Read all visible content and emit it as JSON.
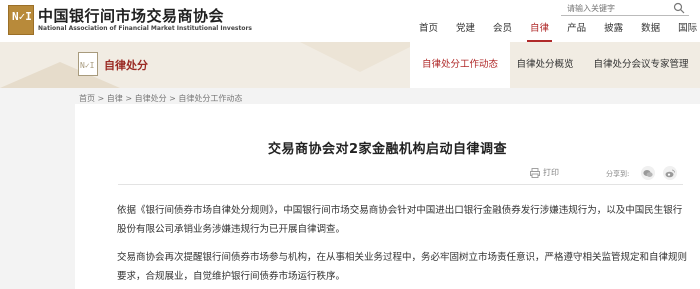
{
  "header": {
    "brand_cn": "中国银行间市场交易商协会",
    "brand_en": "National Association of Financial Market Institutional Investors",
    "logo_mark": "N✓I",
    "search_placeholder": "请输入关键字"
  },
  "nav": {
    "items": [
      "首页",
      "党建",
      "会员",
      "自律",
      "产品",
      "披露",
      "数据",
      "国际"
    ],
    "active": "自律"
  },
  "banner": {
    "title": "自律处分",
    "logo_mark": "N✓I"
  },
  "subtabs": [
    "自律处分工作动态",
    "自律处分概览",
    "自律处分会议专家管理"
  ],
  "breadcrumb": "首页 > 自律 > 自律处分 > 自律处分工作动态",
  "article": {
    "title": "交易商协会对2家金融机构启动自律调查",
    "print_label": "打印",
    "share_label": "分享到:",
    "paragraphs": [
      "依据《银行间债券市场自律处分规则》，中国银行间市场交易商协会针对中国进出口银行金融债券发行涉嫌违规行为，以及中国民生银行股份有限公司承销业务涉嫌违规行为已开展自律调查。",
      "交易商协会再次提醒银行间债券市场参与机构，在从事相关业务过程中，务必牢固树立市场责任意识，严格遵守相关监管规定和自律规则要求，合规展业，自觉维护银行间债券市场运行秩序。"
    ]
  },
  "colors": {
    "accent": "#b02a2a",
    "logo": "#b88a3a",
    "banner_bg": "#f1ece3"
  }
}
